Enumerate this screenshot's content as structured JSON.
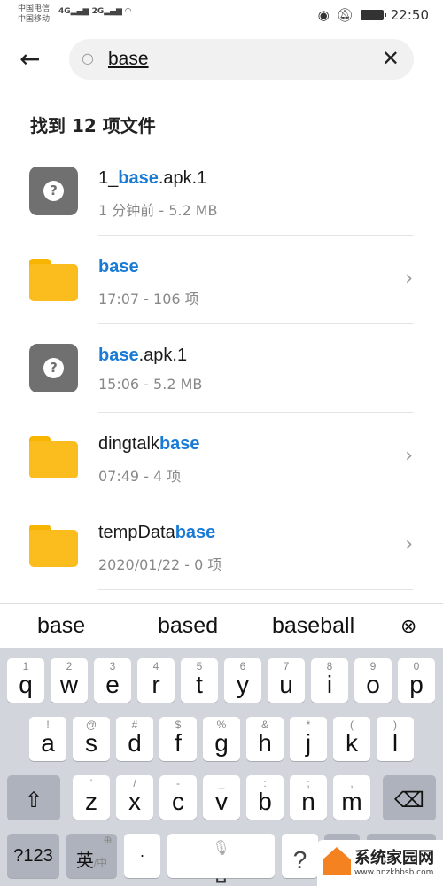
{
  "status": {
    "carrier1": "中国电信",
    "carrier2": "中国移动",
    "sig1": "4G",
    "sig2": "2G",
    "time": "22:50"
  },
  "search": {
    "value": "base",
    "placeholder": ""
  },
  "found": "找到 12 项文件",
  "accent": "#1a7bd6",
  "items": [
    {
      "type": "file",
      "pre": "1_",
      "hl": "base",
      "post": ".apk.1",
      "sub": "1 分钟前 - 5.2 MB",
      "chevron": false
    },
    {
      "type": "folder",
      "pre": "",
      "hl": "base",
      "post": "",
      "sub": "17:07 - 106 项",
      "chevron": true
    },
    {
      "type": "file",
      "pre": "",
      "hl": "base",
      "post": ".apk.1",
      "sub": "15:06 - 5.2 MB",
      "chevron": false
    },
    {
      "type": "folder",
      "pre": "dingtalk",
      "hl": "base",
      "post": "",
      "sub": "07:49 - 4 项",
      "chevron": true
    },
    {
      "type": "folder",
      "pre": "tempData",
      "hl": "base",
      "post": "",
      "sub": "2020/01/22 - 0 项",
      "chevron": true
    }
  ],
  "suggestions": [
    "base",
    "based",
    "baseball"
  ],
  "keyboard": {
    "row1": [
      [
        "q",
        "1"
      ],
      [
        "w",
        "2"
      ],
      [
        "e",
        "3"
      ],
      [
        "r",
        "4"
      ],
      [
        "t",
        "5"
      ],
      [
        "y",
        "6"
      ],
      [
        "u",
        "7"
      ],
      [
        "i",
        "8"
      ],
      [
        "o",
        "9"
      ],
      [
        "p",
        "0"
      ]
    ],
    "row2": [
      [
        "a",
        "!"
      ],
      [
        "s",
        "@"
      ],
      [
        "d",
        "#"
      ],
      [
        "f",
        "$"
      ],
      [
        "g",
        "%"
      ],
      [
        "h",
        "&"
      ],
      [
        "j",
        "*"
      ],
      [
        "k",
        "("
      ],
      [
        "l",
        ")"
      ]
    ],
    "row3": [
      [
        "z",
        "'"
      ],
      [
        "x",
        "/"
      ],
      [
        "c",
        "-"
      ],
      [
        "v",
        "_"
      ],
      [
        "b",
        ":"
      ],
      [
        "n",
        ";"
      ],
      [
        "m",
        ","
      ]
    ],
    "sym": "?123",
    "lang": "英",
    "lang2": "/中",
    "dot": "·",
    "q": "?"
  },
  "watermark": {
    "name": "系统家园网",
    "url": "www.hnzkhbsb.com"
  }
}
